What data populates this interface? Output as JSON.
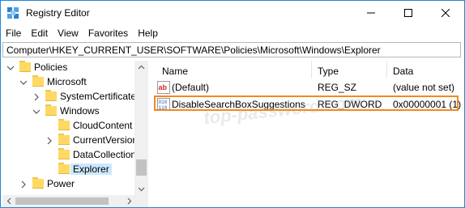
{
  "window": {
    "title": "Registry Editor"
  },
  "menu": [
    "File",
    "Edit",
    "View",
    "Favorites",
    "Help"
  ],
  "address": "Computer\\HKEY_CURRENT_USER\\SOFTWARE\\Policies\\Microsoft\\Windows\\Explorer",
  "tree": [
    {
      "label": "Policies"
    },
    {
      "label": "Microsoft"
    },
    {
      "label": "SystemCertificate"
    },
    {
      "label": "Windows"
    },
    {
      "label": "CloudContent"
    },
    {
      "label": "CurrentVersion"
    },
    {
      "label": "DataCollection"
    },
    {
      "label": "Explorer"
    },
    {
      "label": "Power"
    }
  ],
  "columns": {
    "name": "Name",
    "type": "Type",
    "data": "Data"
  },
  "values": [
    {
      "name": "(Default)",
      "type": "REG_SZ",
      "data": "(value not set)",
      "icon": "string-value-icon"
    },
    {
      "name": "DisableSearchBoxSuggestions",
      "type": "REG_DWORD",
      "data": "0x00000001 (1)",
      "icon": "dword-value-icon"
    }
  ],
  "watermark": "top-password.com",
  "colors": {
    "highlight": "#f08a24",
    "selection": "#cce8ff",
    "folder": "#ffd963"
  }
}
